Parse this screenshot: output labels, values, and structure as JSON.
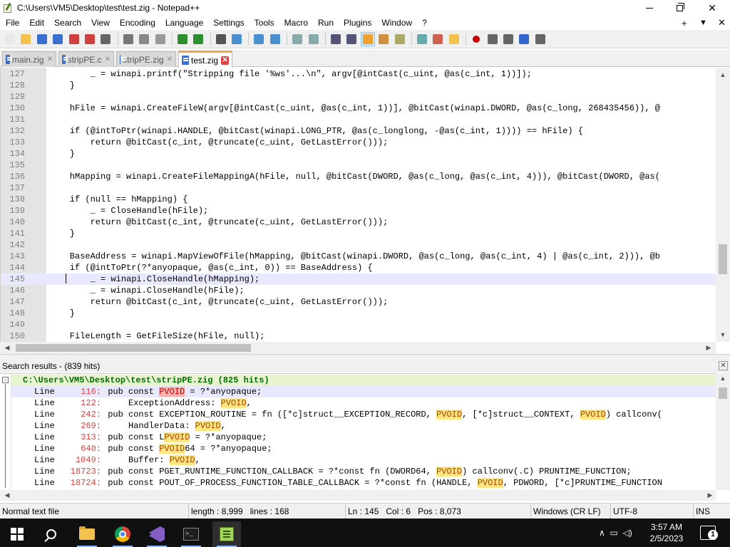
{
  "window": {
    "title": "C:\\Users\\VM5\\Desktop\\test\\test.zig - Notepad++",
    "min_label": "─",
    "close_label": "✕"
  },
  "menu": {
    "items": [
      "File",
      "Edit",
      "Search",
      "View",
      "Encoding",
      "Language",
      "Settings",
      "Tools",
      "Macro",
      "Run",
      "Plugins",
      "Window",
      "?"
    ],
    "plus": "+",
    "dropdown": "▼",
    "close": "✕"
  },
  "toolbar": {
    "icons": [
      "new-file-icon",
      "open-file-icon",
      "save-icon",
      "save-all-icon",
      "close-icon",
      "close-all-icon",
      "print-icon",
      "cut-icon",
      "copy-icon",
      "paste-icon",
      "undo-icon",
      "redo-icon",
      "find-icon",
      "replace-icon",
      "zoom-in-icon",
      "zoom-out-icon",
      "sync-vertical-icon",
      "sync-horizontal-icon",
      "word-wrap-icon",
      "show-all-chars-icon",
      "indent-guide-icon",
      "user-lang-icon",
      "doc-map-icon",
      "function-list-icon",
      "folder-workspace-icon",
      "monitoring-icon",
      "record-macro-icon",
      "stop-macro-icon",
      "play-macro-icon",
      "run-macro-multiple-icon",
      "save-macro-icon"
    ]
  },
  "tabs": [
    {
      "label": "main.zig",
      "close": "✕"
    },
    {
      "label": "stripPE.c",
      "close": "✕"
    },
    {
      "label": "stripPE.zig",
      "close": "✕"
    },
    {
      "label": "test.zig",
      "close": "✕"
    }
  ],
  "editor": {
    "lines": [
      {
        "num": "127",
        "text": "        _ = winapi.printf(\"Stripping file '%ws'...\\n\", argv[@intCast(c_uint, @as(c_int, 1))]);"
      },
      {
        "num": "128",
        "text": "    }"
      },
      {
        "num": "129",
        "text": ""
      },
      {
        "num": "130",
        "text": "    hFile = winapi.CreateFileW(argv[@intCast(c_uint, @as(c_int, 1))], @bitCast(winapi.DWORD, @as(c_long, 268435456)), @"
      },
      {
        "num": "131",
        "text": ""
      },
      {
        "num": "132",
        "text": "    if (@intToPtr(winapi.HANDLE, @bitCast(winapi.LONG_PTR, @as(c_longlong, -@as(c_int, 1)))) == hFile) {"
      },
      {
        "num": "133",
        "text": "        return @bitCast(c_int, @truncate(c_uint, GetLastError()));"
      },
      {
        "num": "134",
        "text": "    }"
      },
      {
        "num": "135",
        "text": ""
      },
      {
        "num": "136",
        "text": "    hMapping = winapi.CreateFileMappingA(hFile, null, @bitCast(DWORD, @as(c_long, @as(c_int, 4))), @bitCast(DWORD, @as("
      },
      {
        "num": "137",
        "text": ""
      },
      {
        "num": "138",
        "text": "    if (null == hMapping) {"
      },
      {
        "num": "139",
        "text": "        _ = CloseHandle(hFile);"
      },
      {
        "num": "140",
        "text": "        return @bitCast(c_int, @truncate(c_uint, GetLastError()));"
      },
      {
        "num": "141",
        "text": "    }"
      },
      {
        "num": "142",
        "text": ""
      },
      {
        "num": "143",
        "text": "    BaseAddress = winapi.MapViewOfFile(hMapping, @bitCast(winapi.DWORD, @as(c_long, @as(c_int, 4) | @as(c_int, 2))), @b"
      },
      {
        "num": "144",
        "text": "    if (@intToPtr(?*anyopaque, @as(c_int, 0)) == BaseAddress) {"
      },
      {
        "num": "145",
        "text": "        _ = winapi.CloseHandle(hMapping);"
      },
      {
        "num": "146",
        "text": "        _ = winapi.CloseHandle(hFile);"
      },
      {
        "num": "147",
        "text": "        return @bitCast(c_int, @truncate(c_uint, GetLastError()));"
      },
      {
        "num": "148",
        "text": "    }"
      },
      {
        "num": "149",
        "text": ""
      },
      {
        "num": "150",
        "text": "    FileLength = GetFileSize(hFile, null);"
      }
    ],
    "current_line": 18
  },
  "search_results": {
    "header": "Search results - (839 hits)",
    "file_line": "C:\\Users\\VM5\\Desktop\\test\\stripPE.zig (825 hits)",
    "rows": [
      {
        "label": "Line",
        "num": "116:",
        "pre": " pub const ",
        "hit": "PVOID",
        "post": " = ?*anyopaque;",
        "red": true
      },
      {
        "label": "Line",
        "num": "122:",
        "pre": "     ExceptionAddress: ",
        "hit": "PVOID",
        "post": ",",
        "red": false
      },
      {
        "label": "Line",
        "num": "242:",
        "pre": " pub const EXCEPTION_ROUTINE = fn ([*c]struct__EXCEPTION_RECORD, ",
        "hit": "PVOID",
        "post": ", [*c]struct__CONTEXT, ",
        "hit2": "PVOID",
        "post2": ") callconv(",
        "red": false
      },
      {
        "label": "Line",
        "num": "269:",
        "pre": "     HandlerData: ",
        "hit": "PVOID",
        "post": ",",
        "red": false
      },
      {
        "label": "Line",
        "num": "313:",
        "pre": " pub const L",
        "hit": "PVOID",
        "post": " = ?*anyopaque;",
        "red": false
      },
      {
        "label": "Line",
        "num": "640:",
        "pre": " pub const ",
        "hit": "PVOID",
        "post": "64 = ?*anyopaque;",
        "red": false
      },
      {
        "label": "Line",
        "num": "1049:",
        "pre": "     Buffer: ",
        "hit": "PVOID",
        "post": ",",
        "red": false
      },
      {
        "label": "Line",
        "num": "18723:",
        "pre": " pub const PGET_RUNTIME_FUNCTION_CALLBACK = ?*const fn (DWORD64, ",
        "hit": "PVOID",
        "post": ") callconv(.C) PRUNTIME_FUNCTION;",
        "red": false
      },
      {
        "label": "Line",
        "num": "18724:",
        "pre": " pub const POUT_OF_PROCESS_FUNCTION_TABLE_CALLBACK = ?*const fn (HANDLE, ",
        "hit": "PVOID",
        "post": ", PDWORD, [*c]PRUNTIME_FUNCTION",
        "red": false
      }
    ]
  },
  "status": {
    "type": "Normal text file",
    "length": "length : 8,999",
    "lines": "lines : 168",
    "ln": "Ln : 145",
    "col": "Col : 6",
    "pos": "Pos : 8,073",
    "eol": "Windows (CR LF)",
    "encoding": "UTF-8",
    "mode": "INS"
  },
  "taskbar": {
    "time": "3:57 AM",
    "date": "2/5/2023",
    "notifications": "1",
    "terminal_text": ">_"
  }
}
